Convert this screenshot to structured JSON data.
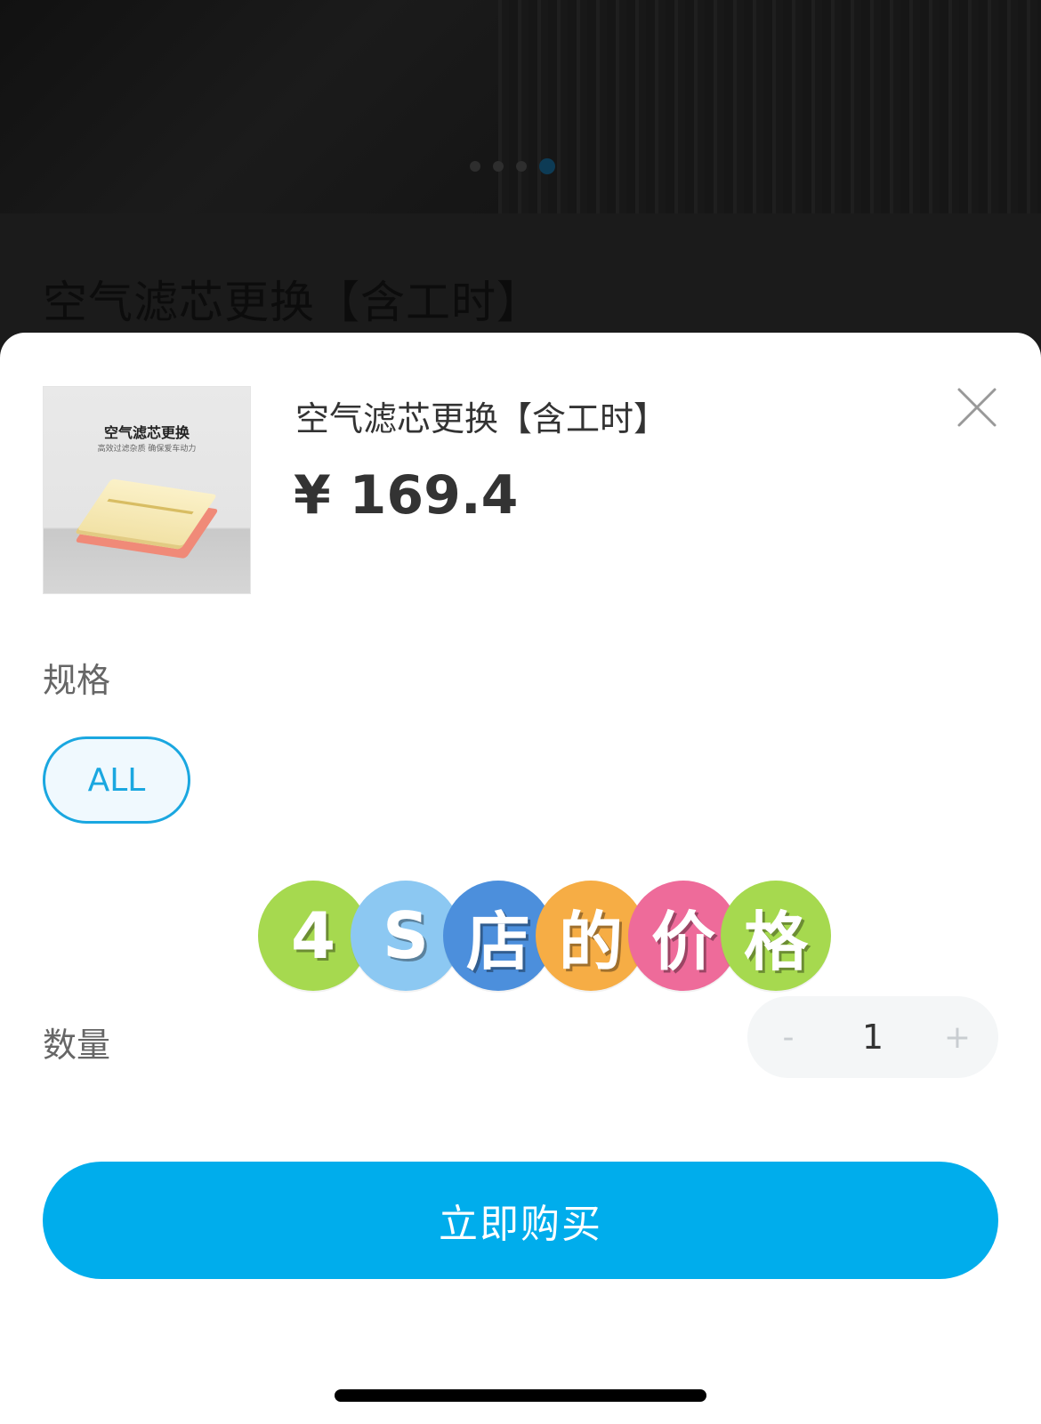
{
  "background": {
    "title": "空气滤芯更换【含工时】",
    "carousel_dot_count": 4,
    "carousel_active_index": 3
  },
  "product": {
    "title": "空气滤芯更换【含工时】",
    "price": "¥ 169.4",
    "thumbnail": {
      "title": "空气滤芯更换",
      "subtitle": "高效过滤杂质 确保爱车动力"
    }
  },
  "spec": {
    "label": "规格",
    "options": [
      "ALL"
    ],
    "selected": "ALL"
  },
  "sticker": {
    "chars": [
      "4",
      "S",
      "店",
      "的",
      "价",
      "格"
    ],
    "colors": [
      "#a6d94f",
      "#8cc8f2",
      "#4c8fdc",
      "#f6ad45",
      "#ee6b9a",
      "#a6d94f"
    ]
  },
  "quantity": {
    "label": "数量",
    "value": "1",
    "minus": "-",
    "plus": "+"
  },
  "actions": {
    "buy_label": "立即购买"
  },
  "colors": {
    "accent": "#00adec",
    "chip_border": "#1aa7e0",
    "text_primary": "#333333"
  },
  "icons": {
    "close": "close-icon"
  }
}
